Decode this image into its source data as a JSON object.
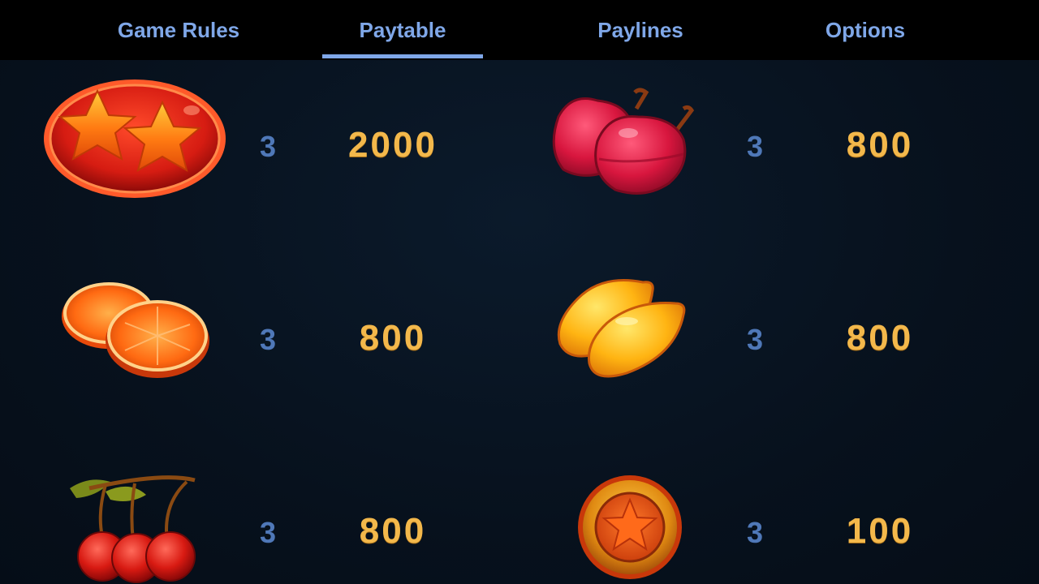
{
  "tabs": [
    {
      "label": "Game Rules",
      "active": false
    },
    {
      "label": "Paytable",
      "active": true
    },
    {
      "label": "Paylines",
      "active": false
    },
    {
      "label": "Options",
      "active": false
    }
  ],
  "paytable": [
    {
      "symbol": "double-star-icon",
      "count": "3",
      "payout": "2000"
    },
    {
      "symbol": "plum-icon",
      "count": "3",
      "payout": "800"
    },
    {
      "symbol": "orange-icon",
      "count": "3",
      "payout": "800"
    },
    {
      "symbol": "lemon-icon",
      "count": "3",
      "payout": "800"
    },
    {
      "symbol": "cherry-icon",
      "count": "3",
      "payout": "800"
    },
    {
      "symbol": "star-coin-icon",
      "count": "3",
      "payout": "100"
    }
  ],
  "colors": {
    "tab_text": "#7fa7e8",
    "count_text": "#4f78b8",
    "payout_text": "#f3b84b",
    "background": "#07111d"
  }
}
